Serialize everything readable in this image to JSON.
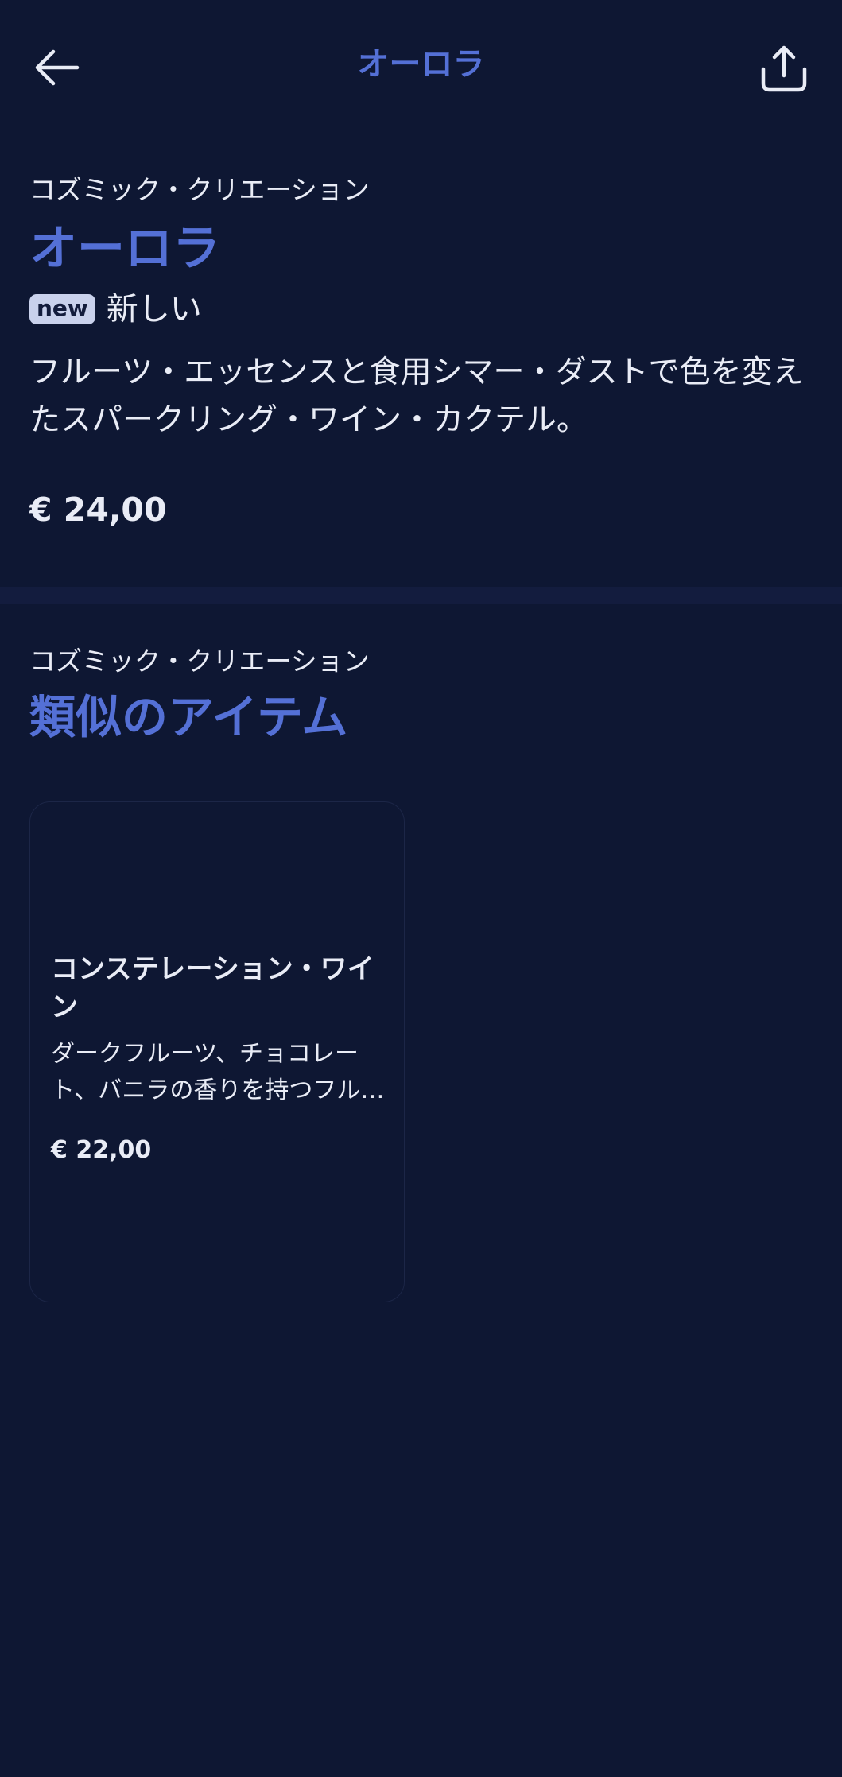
{
  "header": {
    "title": "オーロラ",
    "back_icon": "arrow-left-icon",
    "share_icon": "share-icon"
  },
  "product": {
    "category": "コズミック・クリエーション",
    "name": "オーロラ",
    "badge": "new",
    "badge_label": "新しい",
    "description": "フルーツ・エッセンスと食用シマー・ダストで色を変えたスパークリング・ワイン・カクテル。",
    "price": "€ 24,00"
  },
  "similar": {
    "category": "コズミック・クリエーション",
    "title": "類似のアイテム",
    "items": [
      {
        "name": "コンステレーション・ワイン",
        "description": "ダークフルーツ、チョコレート、バニラの香りを持つフル…",
        "price": "€ 22,00"
      }
    ]
  },
  "colors": {
    "background": "#0e1733",
    "accent": "#5470d6",
    "text": "#e9ecf6",
    "badge_bg": "#c9d1ec"
  }
}
